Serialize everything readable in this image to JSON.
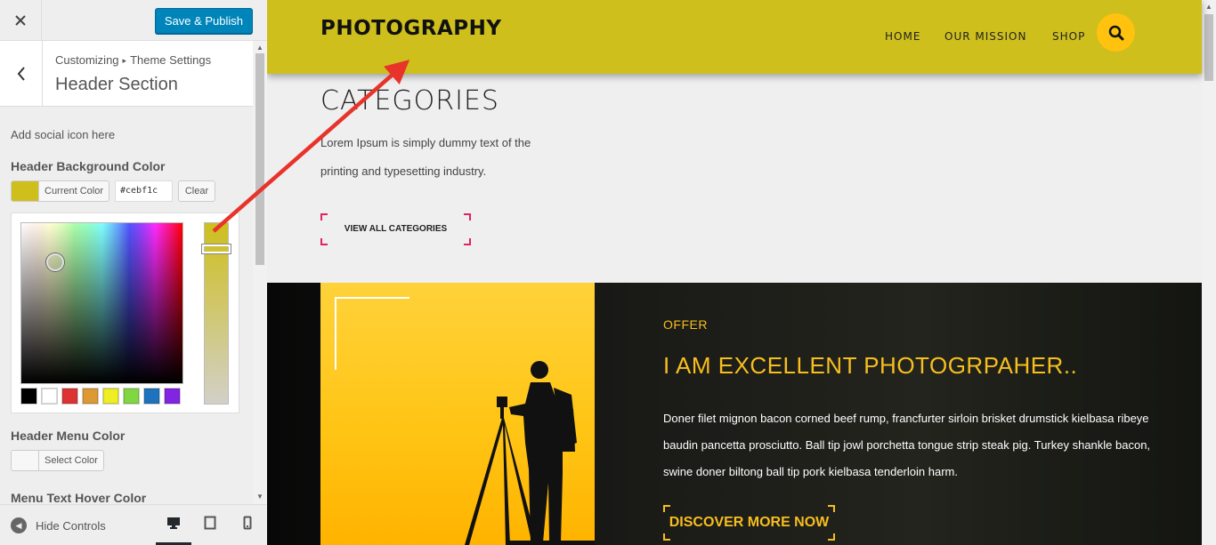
{
  "sidebar": {
    "close_icon": "close-icon",
    "publish_label": "Save & Publish",
    "breadcrumb": {
      "root": "Customizing",
      "separator": "▸",
      "parent": "Theme Settings"
    },
    "section_title": "Header Section",
    "social_hint": "Add social icon here",
    "header_bg": {
      "label": "Header Background Color",
      "current_color_label": "Current Color",
      "hex_value": "#cebf1c",
      "clear_label": "Clear",
      "swatch_color": "#cebf1c"
    },
    "palette": [
      "#000000",
      "#ffffff",
      "#dd3333",
      "#dd9933",
      "#eeee22",
      "#81d742",
      "#1e73be",
      "#8224e3"
    ],
    "menu_color": {
      "label": "Header Menu Color",
      "select_label": "Select Color"
    },
    "hover_color": {
      "label": "Menu Text Hover Color"
    },
    "footer": {
      "hide_label": "Hide Controls",
      "devices": [
        "desktop",
        "tablet",
        "mobile"
      ]
    }
  },
  "preview": {
    "header": {
      "background": "#cebf1c",
      "site_title": "PHOTOGRAPHY",
      "nav": [
        "HOME",
        "OUR MISSION",
        "SHOP"
      ],
      "search_icon": "search-icon"
    },
    "categories": {
      "title": "CATEGORIES",
      "text": "Lorem Ipsum is simply dummy text of the printing and typesetting industry.",
      "button": "VIEW ALL CATEGORIES"
    },
    "feature": {
      "kicker": "OFFER",
      "heading": "I AM EXCELLENT PHOTOGRPAHER..",
      "body": "Doner filet mignon bacon corned beef rump, francfurter sirloin brisket drumstick kielbasa ribeye baudin pancetta prosciutto. Ball tip jowl porchetta tongue strip steak pig. Turkey shankle bacon, swine doner biltong ball tip pork kielbasa tenderloin harm.",
      "button": "DISCOVER MORE NOW"
    }
  },
  "annotation": {
    "arrow_color": "#e8332a"
  }
}
